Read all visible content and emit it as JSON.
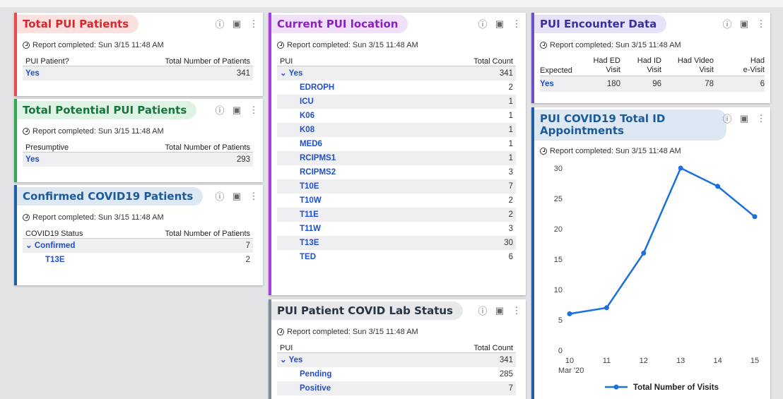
{
  "colors": {
    "red": "#e94a4f",
    "green": "#33a852",
    "blue": "#1e5fa8",
    "purple": "#a83be0",
    "slate": "#7d8b99",
    "link": "#1f4fd1",
    "line": "#1b6fe0"
  },
  "report_text": "Report completed: Sun 3/15 11:48 AM",
  "tool_icons": [
    "info-icon",
    "bookmark-icon",
    "more-vertical-icon"
  ],
  "tool_glyphs": {
    "info": "ⓘ",
    "bookmark": "▣",
    "more": "⋮"
  },
  "total_pui": {
    "title": "Total PUI Patients",
    "headers": [
      "PUI Patient?",
      "Total Number of Patients"
    ],
    "rows": [
      {
        "label": "Yes",
        "value": "341"
      }
    ]
  },
  "potential_pui": {
    "title": "Total Potential PUI Patients",
    "headers": [
      "Presumptive",
      "Total Number of Patients"
    ],
    "rows": [
      {
        "label": "Yes",
        "value": "293"
      }
    ]
  },
  "confirmed": {
    "title": "Confirmed COVID19 Patients",
    "headers": [
      "COVID19 Status",
      "Total Number of Patients"
    ],
    "rows": [
      {
        "label": "Confirmed",
        "value": "7"
      },
      {
        "label": "T13E",
        "value": "2"
      }
    ]
  },
  "location": {
    "title": "Current PUI location",
    "headers": [
      "PUI",
      "Total Count"
    ],
    "group": {
      "label": "Yes",
      "value": "341"
    },
    "rows": [
      {
        "label": "EDROPH",
        "value": "2"
      },
      {
        "label": "ICU",
        "value": "1"
      },
      {
        "label": "K06",
        "value": "1"
      },
      {
        "label": "K08",
        "value": "1"
      },
      {
        "label": "MED6",
        "value": "1"
      },
      {
        "label": "RCIPMS1",
        "value": "1"
      },
      {
        "label": "RCIPMS2",
        "value": "3"
      },
      {
        "label": "T10E",
        "value": "7"
      },
      {
        "label": "T10W",
        "value": "2"
      },
      {
        "label": "T11E",
        "value": "2"
      },
      {
        "label": "T11W",
        "value": "3"
      },
      {
        "label": "T13E",
        "value": "30"
      },
      {
        "label": "TED",
        "value": "6"
      }
    ]
  },
  "lab": {
    "title": "PUI Patient COVID Lab Status",
    "headers": [
      "PUI",
      "Total Count"
    ],
    "group": {
      "label": "Yes",
      "value": "341"
    },
    "rows": [
      {
        "label": "Pending",
        "value": "285"
      },
      {
        "label": "Positive",
        "value": "7"
      }
    ]
  },
  "encounter": {
    "title": "PUI Encounter Data",
    "headers": [
      "Expected",
      "Had ED Visit",
      "Had ID Visit",
      "Had Video Visit",
      "Had e-Visit"
    ],
    "header_lines": [
      [
        "Expected"
      ],
      [
        "Had ED",
        "Visit"
      ],
      [
        "Had ID",
        "Visit"
      ],
      [
        "Had Video",
        "Visit"
      ],
      [
        "Had",
        "e-Visit"
      ]
    ],
    "row": [
      "Yes",
      "180",
      "96",
      "78",
      "6"
    ]
  },
  "id_appointments": {
    "title_lines": [
      "PUI COVID19 Total ID",
      "Appointments"
    ]
  },
  "chart_data": {
    "type": "line",
    "title": "PUI COVID19 Total ID Appointments",
    "x": [
      10,
      11,
      12,
      13,
      14,
      15
    ],
    "x_tick_labels": [
      "10",
      "11",
      "12",
      "13",
      "14",
      "15"
    ],
    "x_sublabel": "Mar '20",
    "series": [
      {
        "name": "Total Number of Visits",
        "values": [
          6,
          7,
          16,
          30,
          27,
          22
        ]
      }
    ],
    "y_ticks": [
      0,
      5,
      10,
      15,
      20,
      25,
      30
    ],
    "ylim": [
      0,
      30
    ],
    "grid": false,
    "legend": "bottom"
  }
}
